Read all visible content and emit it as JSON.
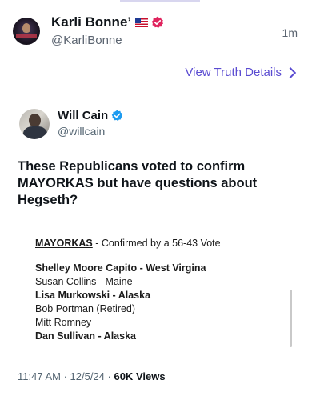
{
  "post": {
    "display_name": "Karli Bonne’",
    "handle": "@KarliBonne",
    "time": "1m",
    "view_details_label": "View Truth Details"
  },
  "tweet": {
    "display_name": "Will Cain",
    "handle": "@willcain",
    "text": "These Republicans voted to confirm MAYORKAS but have questions about Hegseth?",
    "image": {
      "heading_name": "MAYORKAS",
      "heading_rest": " - Confirmed by a 56-43 Vote",
      "senators": [
        {
          "text": "Shelley Moore Capito - West Virgina",
          "bold": true
        },
        {
          "text": "Susan Collins - Maine",
          "bold": false
        },
        {
          "text": "Lisa Murkowski - Alaska",
          "bold": true
        },
        {
          "text": "Bob Portman (Retired)",
          "bold": false
        },
        {
          "text": "Mitt Romney",
          "bold": false
        },
        {
          "text": "Dan Sullivan - Alaska",
          "bold": true
        }
      ]
    },
    "meta": {
      "time": "11:47 AM",
      "date": "12/5/24",
      "separator": " · ",
      "views_count": "60K",
      "views_label": "Views"
    }
  },
  "colors": {
    "accent": "#5a4bd1",
    "verified_blue": "#1d9bf0",
    "verified_red": "#e0245e"
  }
}
